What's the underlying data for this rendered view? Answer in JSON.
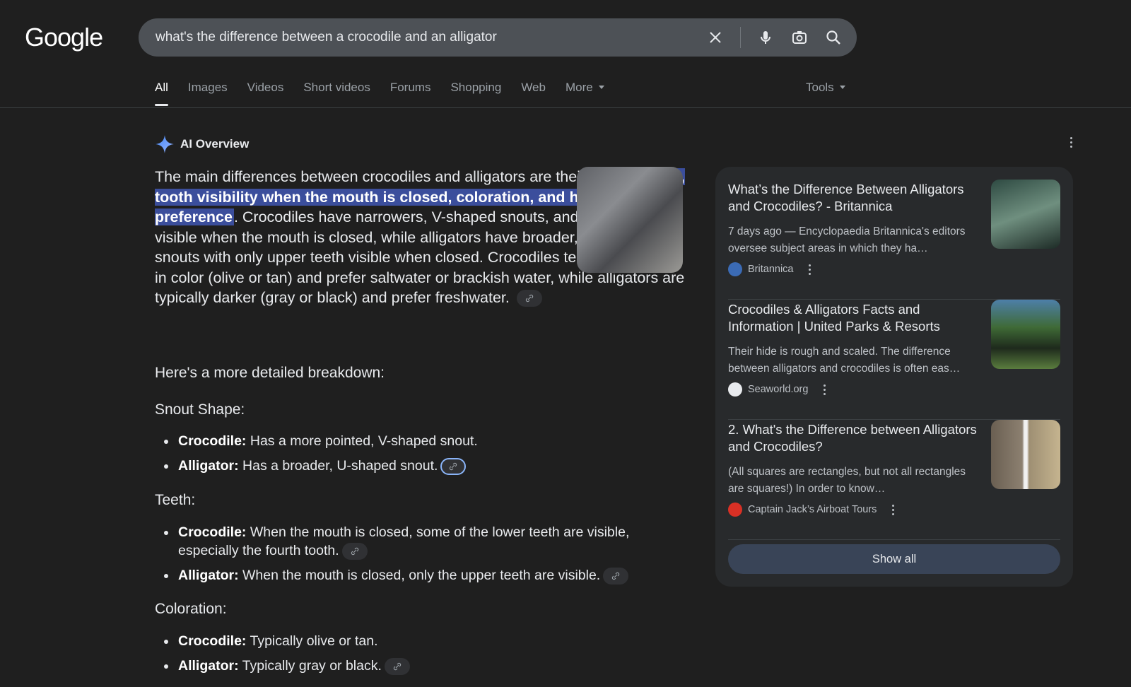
{
  "header": {
    "logo": "Google",
    "search_query": "what's the difference between a crocodile and an alligator"
  },
  "tabs": [
    "All",
    "Images",
    "Videos",
    "Short videos",
    "Forums",
    "Shopping",
    "Web",
    "More"
  ],
  "tools_label": "Tools",
  "ai_overview": {
    "label": "AI Overview",
    "intro_1": "The main differences between crocodiles and alligators are their ",
    "intro_highlight": "snout shape, tooth visibility when the mouth is closed, coloration, and habitat preference",
    "intro_2": ". Crocodiles have narrow­ers, V-shaped snouts, and lower teeth are visible when the mouth is closed, while alligators have broader, U-shaped snouts with only upper teeth visible when closed. Crocodiles tend to be lighter in color (olive or tan) and prefer saltwater or brackish wa­ter, while alligators are typically darker (gray or black) and prefer freshwater.",
    "breakdown_label": "Here's a more detailed breakdown:",
    "sections": [
      {
        "heading": "Snout Shape:",
        "items": [
          {
            "term": "Crocodile:",
            "text": " Has a more pointed, V-shaped snout."
          },
          {
            "term": "Alligator:",
            "text": " Has a broader, U-shaped snout."
          }
        ]
      },
      {
        "heading": "Teeth:",
        "items": [
          {
            "term": "Crocodile:",
            "text": " When the mouth is closed, some of the lower teeth are visible, especially the fourth tooth."
          },
          {
            "term": "Alligator:",
            "text": " When the mouth is closed, only the upper teeth are visible."
          }
        ]
      },
      {
        "heading": "Coloration:",
        "items": [
          {
            "term": "Crocodile:",
            "text": " Typically olive or tan."
          },
          {
            "term": "Alligator:",
            "text": " Typically gray or black."
          }
        ]
      }
    ]
  },
  "sources": [
    {
      "title": "What’s the Difference Between Alligators and Crocodiles? - Britannica",
      "snippet": "7 days ago — Encyclopaedia Britannica's editors oversee subject areas in which they ha…",
      "site": "Britannica",
      "thumb_color": "#4f6b5e",
      "fav_color": "#3b6bb5"
    },
    {
      "title": "Crocodiles & Alligators Facts and Information | United Parks & Resorts",
      "snippet": "Their hide is rough and scaled. The difference between alligators and crocodiles is often eas…",
      "site": "Seaworld.org",
      "thumb_color": "#3f5a3a",
      "fav_color": "#e8eaed"
    },
    {
      "title": "2. What's the Difference between Alligators and Crocodiles?",
      "snippet": "(All squares are rectangles, but not all rectangles are squares!) In order to know…",
      "site": "Captain Jack’s Airboat Tours",
      "thumb_color": "#7b6f5e",
      "fav_color": "#d93025"
    }
  ],
  "show_all_label": "Show all"
}
